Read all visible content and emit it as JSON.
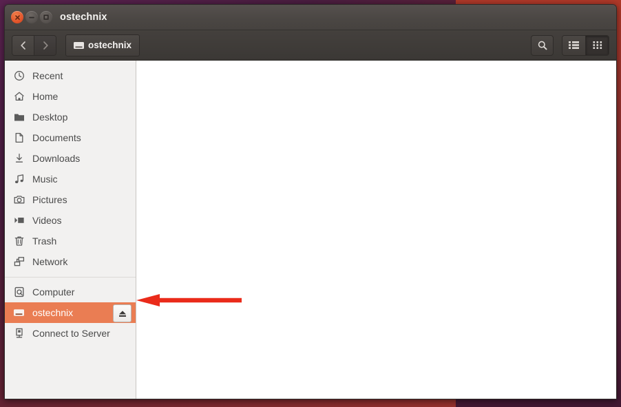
{
  "window": {
    "title": "ostechnix",
    "controls": [
      {
        "name": "close",
        "glyph": "x"
      },
      {
        "name": "minimize",
        "glyph": "minus"
      },
      {
        "name": "maximize",
        "glyph": "square"
      }
    ]
  },
  "toolbar": {
    "back_label": "Back",
    "forward_label": "Forward",
    "path_button": {
      "label": "ostechnix",
      "icon": "drive-icon"
    },
    "search_label": "Search",
    "list_view_label": "List view",
    "grid_view_label": "Icon view",
    "active_view": "grid"
  },
  "sidebar": {
    "items": [
      {
        "label": "Recent",
        "icon": "clock-icon",
        "selected": false
      },
      {
        "label": "Home",
        "icon": "home-icon",
        "selected": false
      },
      {
        "label": "Desktop",
        "icon": "folder-icon",
        "selected": false
      },
      {
        "label": "Documents",
        "icon": "document-icon",
        "selected": false
      },
      {
        "label": "Downloads",
        "icon": "download-icon",
        "selected": false
      },
      {
        "label": "Music",
        "icon": "music-icon",
        "selected": false
      },
      {
        "label": "Pictures",
        "icon": "camera-icon",
        "selected": false
      },
      {
        "label": "Videos",
        "icon": "video-icon",
        "selected": false
      },
      {
        "label": "Trash",
        "icon": "trash-icon",
        "selected": false
      },
      {
        "label": "Network",
        "icon": "network-icon",
        "selected": false
      }
    ],
    "items_lower": [
      {
        "label": "Computer",
        "icon": "computer-icon",
        "selected": false,
        "eject": false
      },
      {
        "label": "ostechnix",
        "icon": "drive-icon",
        "selected": true,
        "eject": true
      },
      {
        "label": "Connect to Server",
        "icon": "server-icon",
        "selected": false,
        "eject": false
      }
    ],
    "eject_label": "Eject"
  },
  "annotation": {
    "arrow_color": "#ea2b1a",
    "arrow_direction": "left",
    "points_to": "ostechnix"
  },
  "colors": {
    "selection": "#ea7d53",
    "sidebar_bg": "#f2f1f0",
    "titlebar": "#4b4744",
    "content_bg": "#ffffff",
    "desktop": "#5a2250"
  }
}
